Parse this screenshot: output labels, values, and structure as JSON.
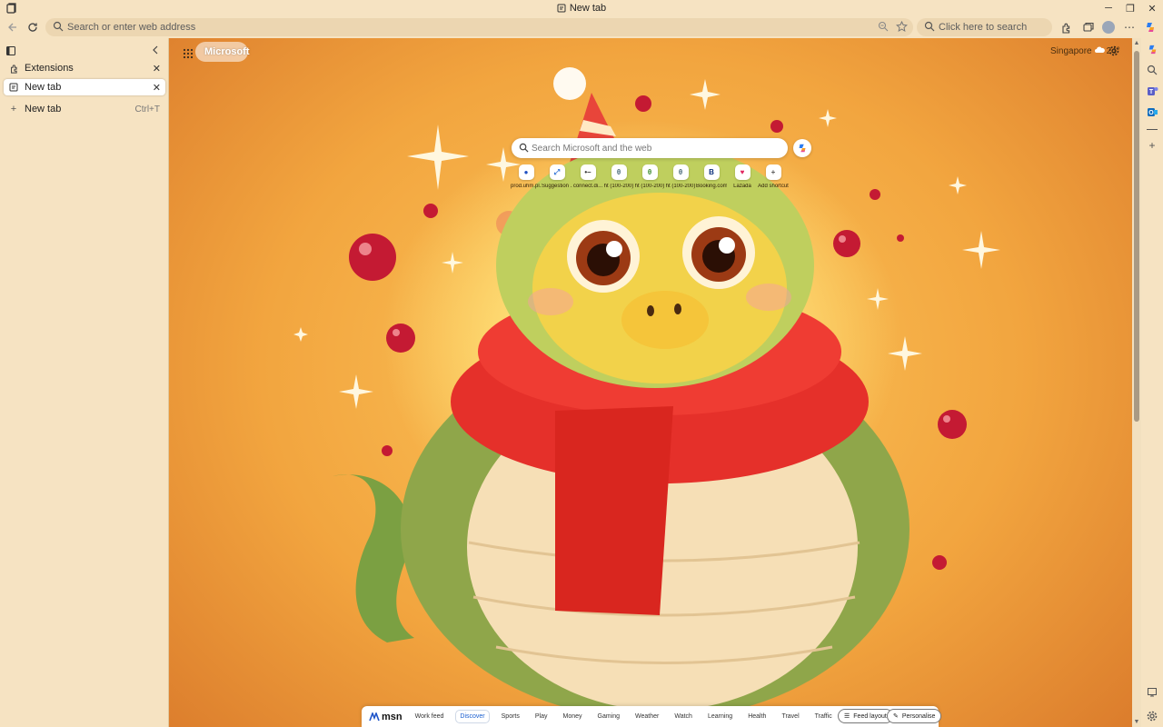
{
  "window": {
    "title": "New tab",
    "controls": [
      "minimize",
      "restore",
      "close"
    ]
  },
  "toolbar": {
    "address_placeholder": "Search or enter web address",
    "search_placeholder": "Click here to search"
  },
  "tabs_panel": {
    "tabs": [
      {
        "label": "Extensions",
        "icon": "extensions-icon"
      },
      {
        "label": "New tab",
        "icon": "page-icon",
        "active": true
      }
    ],
    "new_tab_label": "New tab",
    "new_tab_shortcut": "Ctrl+T"
  },
  "ntp": {
    "brand_label": "Microsoft",
    "weather_location": "Singapore",
    "weather_temp": "24°",
    "search_placeholder": "Search Microsoft and the web",
    "shortcuts": [
      {
        "label": "prod.uhm.pl...",
        "glyph": "●",
        "color": "#1e4fc2"
      },
      {
        "label": "Suggestion ...",
        "glyph": "⤢",
        "color": "#2b6fd6"
      },
      {
        "label": "connect.di...",
        "glyph": "•–",
        "color": "#333333"
      },
      {
        "label": "ht (100-200)",
        "glyph": "θ",
        "color": "#4b6b7a"
      },
      {
        "label": "ht (100-200)",
        "glyph": "θ",
        "color": "#3c8a2e"
      },
      {
        "label": "ht (100-200)",
        "glyph": "θ",
        "color": "#4b6b7a"
      },
      {
        "label": "Booking.com",
        "glyph": "B",
        "color": "#0a2e7a"
      },
      {
        "label": "Lazada",
        "glyph": "♥",
        "color": "#e0245e"
      },
      {
        "label": "Add shortcut",
        "glyph": "+",
        "color": "#555555"
      }
    ],
    "feed": {
      "logo": "msn",
      "tabs": [
        "Work feed",
        "Discover",
        "Sports",
        "Play",
        "Money",
        "Gaming",
        "Weather",
        "Watch",
        "Learning",
        "Health",
        "Travel",
        "Traffic"
      ],
      "active_tab": "Discover",
      "feed_layout_label": "Feed layout",
      "personalise_label": "Personalise"
    }
  },
  "colors": {
    "chrome_bg": "#f6e3c2",
    "active_feed_tab": "#1a5fd0"
  }
}
